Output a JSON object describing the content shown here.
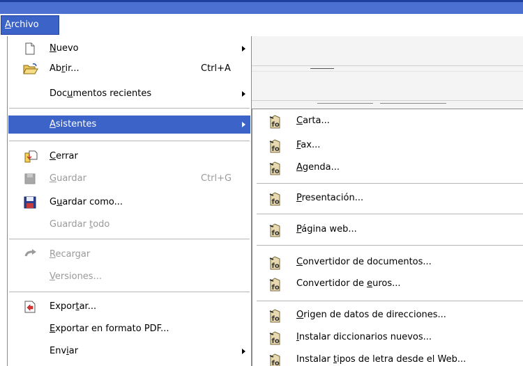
{
  "menubar": {
    "archivo": {
      "before": "",
      "key": "A",
      "after": "rchivo"
    }
  },
  "menu": {
    "items": [
      {
        "before": "",
        "key": "N",
        "after": "uevo",
        "shortcut": "",
        "submenu": true,
        "disabled": false,
        "icon": "new-document-icon"
      },
      {
        "before": "Ab",
        "key": "r",
        "after": "ir...",
        "shortcut": "Ctrl+A",
        "submenu": false,
        "disabled": false,
        "icon": "open-folder-icon"
      },
      {
        "before": "Doc",
        "key": "u",
        "after": "mentos recientes",
        "shortcut": "",
        "submenu": true,
        "disabled": false,
        "icon": ""
      },
      {
        "before": "",
        "key": "A",
        "after": "sistentes",
        "shortcut": "",
        "submenu": true,
        "disabled": false,
        "active": true,
        "icon": ""
      },
      {
        "before": "",
        "key": "C",
        "after": "errar",
        "shortcut": "",
        "submenu": false,
        "disabled": false,
        "icon": "close-document-icon"
      },
      {
        "before": "",
        "key": "G",
        "after": "uardar",
        "shortcut": "Ctrl+G",
        "submenu": false,
        "disabled": true,
        "icon": "save-icon"
      },
      {
        "before": "G",
        "key": "u",
        "after": "ardar como...",
        "shortcut": "",
        "submenu": false,
        "disabled": false,
        "icon": "save-as-icon"
      },
      {
        "before": "Guardar ",
        "key": "t",
        "after": "odo",
        "shortcut": "",
        "submenu": false,
        "disabled": true,
        "icon": ""
      },
      {
        "before": "",
        "key": "R",
        "after": "ecargar",
        "shortcut": "",
        "submenu": false,
        "disabled": true,
        "icon": "reload-icon"
      },
      {
        "before": "",
        "key": "V",
        "after": "ersiones...",
        "shortcut": "",
        "submenu": false,
        "disabled": true,
        "icon": ""
      },
      {
        "before": "Expor",
        "key": "t",
        "after": "ar...",
        "shortcut": "",
        "submenu": false,
        "disabled": false,
        "icon": "export-icon"
      },
      {
        "before": "",
        "key": "E",
        "after": "xportar en formato PDF...",
        "shortcut": "",
        "submenu": false,
        "disabled": false,
        "icon": ""
      },
      {
        "before": "Env",
        "key": "i",
        "after": "ar",
        "shortcut": "",
        "submenu": true,
        "disabled": false,
        "icon": ""
      }
    ]
  },
  "submenu": {
    "items": [
      {
        "before": "",
        "key": "C",
        "after": "arta...",
        "icon": "wizard-icon"
      },
      {
        "before": "",
        "key": "F",
        "after": "ax...",
        "icon": "wizard-icon"
      },
      {
        "before": "",
        "key": "A",
        "after": "genda...",
        "icon": "wizard-icon"
      },
      {
        "before": "",
        "key": "P",
        "after": "resentación...",
        "icon": "wizard-icon"
      },
      {
        "before": "",
        "key": "P",
        "after": "ágina web...",
        "icon": "wizard-icon"
      },
      {
        "before": "",
        "key": "C",
        "after": "onvertidor de documentos...",
        "icon": "wizard-icon"
      },
      {
        "before": "Convertidor de ",
        "key": "e",
        "after": "uros...",
        "icon": "wizard-icon"
      },
      {
        "before": "",
        "key": "O",
        "after": "rigen de datos de direcciones...",
        "icon": "wizard-icon"
      },
      {
        "before": "",
        "key": "I",
        "after": "nstalar diccionarios nuevos...",
        "icon": "wizard-icon"
      },
      {
        "before": "Instalar ",
        "key": "t",
        "after": "ipos de letra desde el Web...",
        "icon": "wizard-icon"
      }
    ]
  },
  "colors": {
    "highlight": "#3c63c7",
    "disabled_text": "#9a9a9a",
    "titlebar": "#4c6fd2"
  }
}
